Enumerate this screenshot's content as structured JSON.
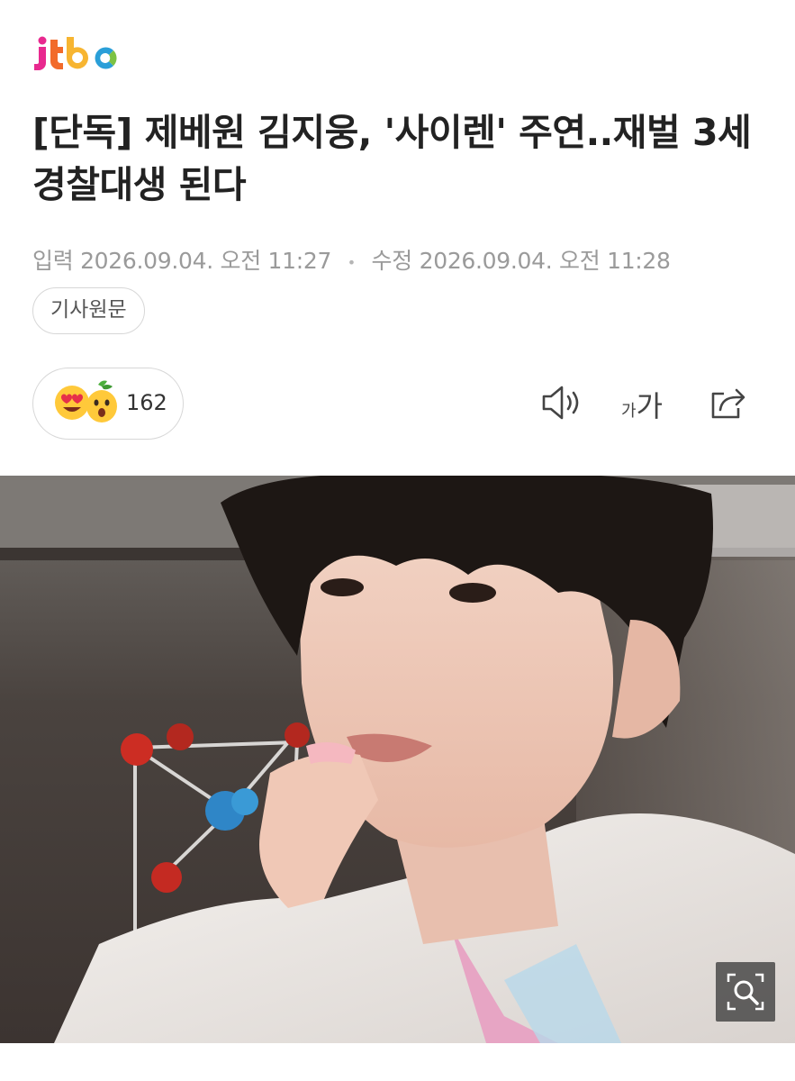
{
  "brand": {
    "logo_text": "jtbc",
    "logo_colors": [
      "#e8298f",
      "#f26b2a",
      "#f7b531",
      "#2a9fd8",
      "#7cc243"
    ]
  },
  "article": {
    "headline": "[단독] 제베원 김지웅, '사이렌' 주연..재벌 3세 경찰대생 된다",
    "published_label": "입력",
    "published": "2026.09.04. 오전 11:27",
    "separator": "•",
    "modified_label": "수정",
    "modified": "2026.09.04. 오전 11:28",
    "source_button": "기사원문"
  },
  "reaction": {
    "count": "162",
    "icons": [
      "heart-eyes-emoji-icon",
      "surprised-emoji-icon"
    ]
  },
  "toolbar": {
    "font_small": "가",
    "font_big": "가",
    "icons": [
      "speaker-icon",
      "font-size-icon",
      "share-icon"
    ]
  },
  "photo": {
    "zoom_icon": "zoom-in-icon"
  }
}
